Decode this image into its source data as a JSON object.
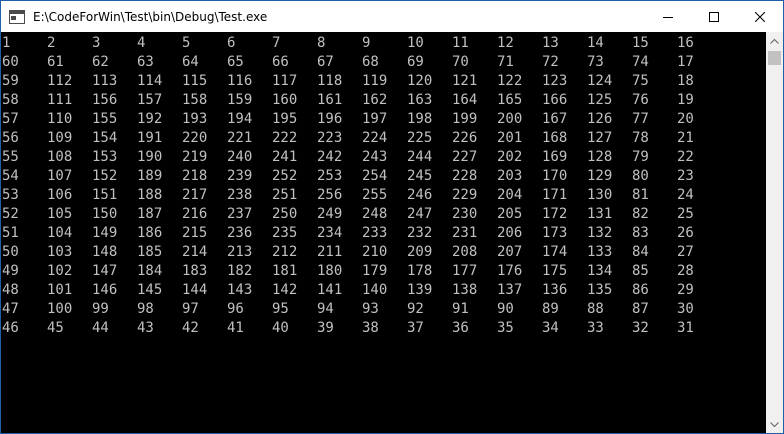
{
  "window": {
    "title": "E:\\CodeForWin\\Test\\bin\\Debug\\Test.exe",
    "icons": {
      "app": "console-app-icon",
      "minimize": "minimize-icon",
      "maximize": "maximize-icon",
      "close": "close-icon",
      "scroll_up": "scroll-up-arrow-icon",
      "scroll_down": "scroll-down-arrow-icon"
    }
  },
  "console": {
    "text_color": "#c0c0c0",
    "background": "#000000",
    "rows": [
      [
        "1",
        "2",
        "3",
        "4",
        "5",
        "6",
        "7",
        "8",
        "9",
        "10",
        "11",
        "12",
        "13",
        "14",
        "15",
        "16"
      ],
      [
        "60",
        "61",
        "62",
        "63",
        "64",
        "65",
        "66",
        "67",
        "68",
        "69",
        "70",
        "71",
        "72",
        "73",
        "74",
        "17"
      ],
      [
        "59",
        "112",
        "113",
        "114",
        "115",
        "116",
        "117",
        "118",
        "119",
        "120",
        "121",
        "122",
        "123",
        "124",
        "75",
        "18"
      ],
      [
        "58",
        "111",
        "156",
        "157",
        "158",
        "159",
        "160",
        "161",
        "162",
        "163",
        "164",
        "165",
        "166",
        "125",
        "76",
        "19"
      ],
      [
        "57",
        "110",
        "155",
        "192",
        "193",
        "194",
        "195",
        "196",
        "197",
        "198",
        "199",
        "200",
        "167",
        "126",
        "77",
        "20"
      ],
      [
        "56",
        "109",
        "154",
        "191",
        "220",
        "221",
        "222",
        "223",
        "224",
        "225",
        "226",
        "201",
        "168",
        "127",
        "78",
        "21"
      ],
      [
        "55",
        "108",
        "153",
        "190",
        "219",
        "240",
        "241",
        "242",
        "243",
        "244",
        "227",
        "202",
        "169",
        "128",
        "79",
        "22"
      ],
      [
        "54",
        "107",
        "152",
        "189",
        "218",
        "239",
        "252",
        "253",
        "254",
        "245",
        "228",
        "203",
        "170",
        "129",
        "80",
        "23"
      ],
      [
        "53",
        "106",
        "151",
        "188",
        "217",
        "238",
        "251",
        "256",
        "255",
        "246",
        "229",
        "204",
        "171",
        "130",
        "81",
        "24"
      ],
      [
        "52",
        "105",
        "150",
        "187",
        "216",
        "237",
        "250",
        "249",
        "248",
        "247",
        "230",
        "205",
        "172",
        "131",
        "82",
        "25"
      ],
      [
        "51",
        "104",
        "149",
        "186",
        "215",
        "236",
        "235",
        "234",
        "233",
        "232",
        "231",
        "206",
        "173",
        "132",
        "83",
        "26"
      ],
      [
        "50",
        "103",
        "148",
        "185",
        "214",
        "213",
        "212",
        "211",
        "210",
        "209",
        "208",
        "207",
        "174",
        "133",
        "84",
        "27"
      ],
      [
        "49",
        "102",
        "147",
        "184",
        "183",
        "182",
        "181",
        "180",
        "179",
        "178",
        "177",
        "176",
        "175",
        "134",
        "85",
        "28"
      ],
      [
        "48",
        "101",
        "146",
        "145",
        "144",
        "143",
        "142",
        "141",
        "140",
        "139",
        "138",
        "137",
        "136",
        "135",
        "86",
        "29"
      ],
      [
        "47",
        "100",
        "99",
        "98",
        "97",
        "96",
        "95",
        "94",
        "93",
        "92",
        "91",
        "90",
        "89",
        "88",
        "87",
        "30"
      ],
      [
        "46",
        "45",
        "44",
        "43",
        "42",
        "41",
        "40",
        "39",
        "38",
        "37",
        "36",
        "35",
        "34",
        "33",
        "32",
        "31"
      ]
    ]
  }
}
